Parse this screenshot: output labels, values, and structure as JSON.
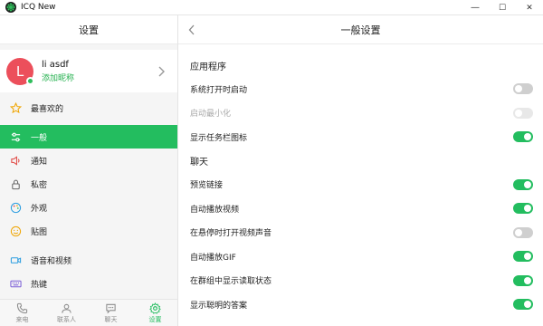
{
  "window": {
    "title": "ICQ New",
    "minimize": "—",
    "maximize": "☐",
    "close": "✕"
  },
  "left": {
    "header": "设置",
    "profile": {
      "initial": "L",
      "name": "li asdf",
      "subtitle": "添加昵称",
      "avatar_color": "#ec4f5b"
    },
    "menu": [
      {
        "label": "最喜欢的",
        "icon": "star-icon"
      },
      {
        "label": "一般",
        "icon": "sliders-icon",
        "active": true
      },
      {
        "label": "通知",
        "icon": "speaker-icon"
      },
      {
        "label": "私密",
        "icon": "lock-icon"
      },
      {
        "label": "外观",
        "icon": "palette-icon"
      },
      {
        "label": "贴图",
        "icon": "smiley-icon"
      },
      {
        "label": "语音和视频",
        "icon": "video-icon"
      },
      {
        "label": "热键",
        "icon": "keyboard-icon"
      }
    ]
  },
  "bottom_nav": [
    {
      "label": "来电",
      "icon": "phone-icon"
    },
    {
      "label": "联系人",
      "icon": "contacts-icon"
    },
    {
      "label": "聊天",
      "icon": "chat-icon"
    },
    {
      "label": "设置",
      "icon": "settings-icon",
      "active": true
    }
  ],
  "right": {
    "header": "一般设置",
    "sections": [
      {
        "title": "应用程序",
        "rows": [
          {
            "label": "系统打开时启动",
            "state": "off"
          },
          {
            "label": "启动最小化",
            "state": "disabled"
          },
          {
            "label": "显示任务栏图标",
            "state": "on"
          }
        ]
      },
      {
        "title": "聊天",
        "rows": [
          {
            "label": "预览链接",
            "state": "on"
          },
          {
            "label": "自动播放视频",
            "state": "on"
          },
          {
            "label": "在悬停时打开视频声音",
            "state": "off"
          },
          {
            "label": "自动播放GIF",
            "state": "on"
          },
          {
            "label": "在群组中显示读取状态",
            "state": "on"
          },
          {
            "label": "显示聪明的答案",
            "state": "on"
          }
        ]
      }
    ]
  },
  "colors": {
    "accent": "#23bd5f",
    "toggle_off": "#cfcfcf"
  }
}
